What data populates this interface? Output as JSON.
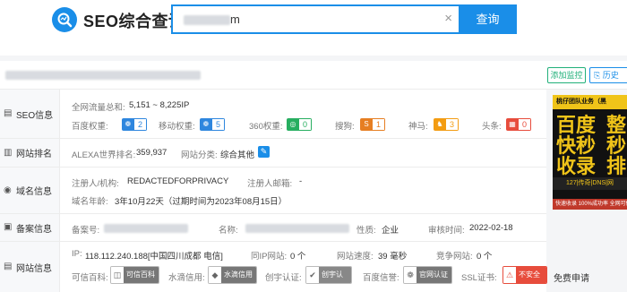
{
  "header": {
    "logo_text": "SEO综合查询",
    "search_value_suffix": "m",
    "clear_symbol": "×",
    "search_button": "查询"
  },
  "domain_bar": {
    "add_monitor": "添加监控",
    "history": "历史"
  },
  "rows": {
    "seo": {
      "label": "SEO信息",
      "traffic_label": "全网流量总和:",
      "traffic_value": "5,151 ~ 8,225IP",
      "weights": [
        {
          "name": "百度权重:",
          "value": "2",
          "color": "#2e86de"
        },
        {
          "name": "移动权重:",
          "value": "5",
          "color": "#2e86de"
        },
        {
          "name": "360权重:",
          "value": "0",
          "color": "#27ae60"
        },
        {
          "name": "搜狗:",
          "value": "1",
          "color": "#e67e22"
        },
        {
          "name": "神马:",
          "value": "3",
          "color": "#f39c12"
        },
        {
          "name": "头条:",
          "value": "0",
          "color": "#e74c3c"
        }
      ]
    },
    "rank": {
      "label": "网站排名",
      "alexa_label": "ALEXA世界排名:",
      "alexa_value": "359,937",
      "category_label": "网站分类:",
      "category_value": "综合其他"
    },
    "whois": {
      "label": "域名信息",
      "registrant_label": "注册人/机构:",
      "registrant_value": "REDACTEDFORPRIVACY",
      "email_label": "注册人邮箱:",
      "email_value": "-",
      "age_label": "域名年龄:",
      "age_value": "3年10月22天（过期时间为2023年08月15日）"
    },
    "icp": {
      "label": "备案信息",
      "icp_label": "备案号:",
      "name_label": "名称:",
      "nature_label": "性质:",
      "nature_value": "企业",
      "audit_label": "审核时间:",
      "audit_value": "2022-02-18"
    },
    "site": {
      "label": "网站信息",
      "ip_label": "IP:",
      "ip_value": "118.112.240.188[中国四川成都 电信]",
      "same_ip_label": "同IP网站:",
      "same_ip_value": "0 个",
      "speed_label": "网站速度:",
      "speed_value": "39 毫秒",
      "competitor_label": "竞争网站:",
      "competitor_value": "0 个",
      "credit_label": "可信百科:",
      "credit_badge": "可信百科",
      "water_label": "水滴信用:",
      "water_badge": "水滴信用",
      "chuangyu_label": "创宇认证:",
      "chuangyu_badge": "创宇认证",
      "baidu_label": "百度信誉:",
      "baidu_badge": "官网认证",
      "ssl_label": "SSL证书:",
      "ssl_badge": "不安全",
      "ssl_apply": "免费申请"
    }
  },
  "ad": {
    "top_text": "桃仔团队业务（黑",
    "line1": "百度",
    "line2": "快秒",
    "line3": "收录",
    "right1": "整",
    "right2": "秒",
    "right3": "排",
    "mid_text": "127|传奇|DNS|网",
    "foot_text": "快速收录 100%成功率 全网可做"
  },
  "colors": {
    "accent": "#1a8ee8",
    "green": "#21b07a"
  }
}
